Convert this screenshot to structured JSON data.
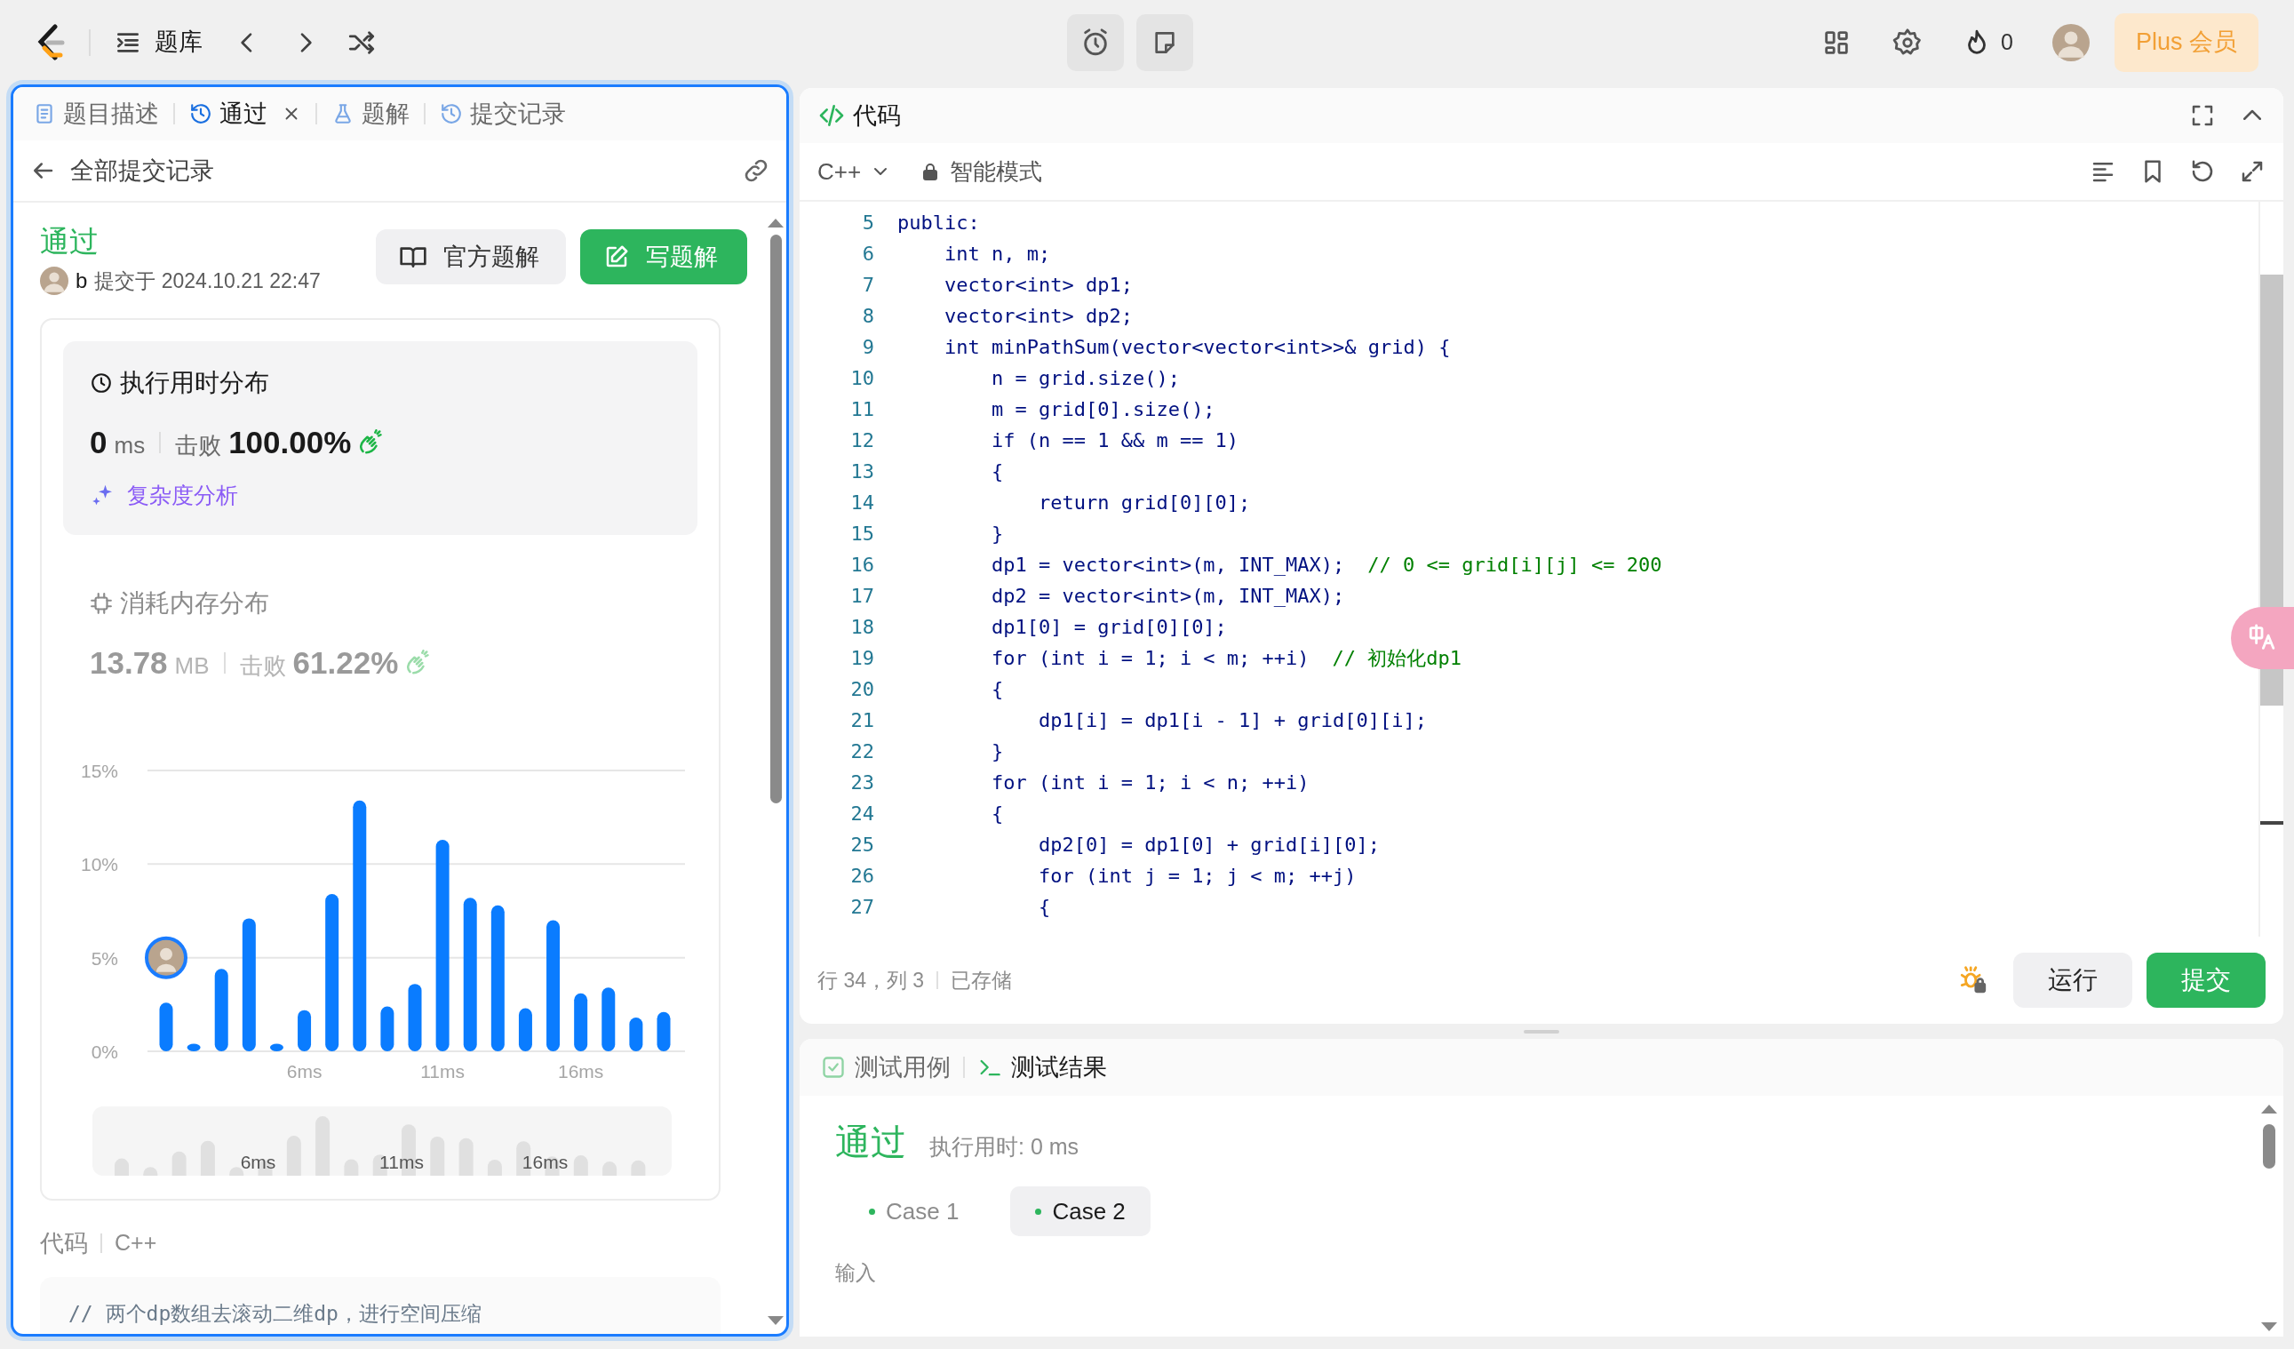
{
  "topbar": {
    "nav_label": "题库",
    "streak": "0",
    "plus_label": "Plus 会员"
  },
  "left_panel": {
    "tabs": [
      {
        "label": "题目描述",
        "selected": false,
        "closable": false
      },
      {
        "label": "通过",
        "selected": true,
        "closable": true
      },
      {
        "label": "题解",
        "selected": false,
        "closable": false
      },
      {
        "label": "提交记录",
        "selected": false,
        "closable": false
      }
    ],
    "back_label": "全部提交记录",
    "submission": {
      "status": "通过",
      "user": "b",
      "submitted": "提交于 2024.10.21 22:47"
    },
    "buttons": [
      {
        "label": "官方题解",
        "kind": "secondary"
      },
      {
        "label": "写题解",
        "kind": "primary"
      }
    ],
    "runtime": {
      "title": "执行用时分布",
      "value": "0",
      "unit": "ms",
      "beat_label": "击败",
      "beat": "100.00%",
      "analysis_link": "复杂度分析",
      "selected": true
    },
    "memory": {
      "title": "消耗内存分布",
      "value": "13.78",
      "unit": "MB",
      "beat_label": "击败",
      "beat": "61.22%",
      "selected": false
    },
    "chart_data": {
      "type": "bar",
      "categories": [
        null,
        null,
        null,
        null,
        null,
        "6ms",
        null,
        null,
        null,
        null,
        "11ms",
        null,
        null,
        null,
        null,
        "16ms",
        null,
        null,
        null
      ],
      "series": [
        {
          "color": "#0a7cff",
          "values": [
            2.6,
            0.4,
            4.4,
            7.1,
            0.4,
            2.2,
            8.4,
            13.4,
            2.4,
            3.6,
            11.3,
            8.2,
            7.8,
            2.3,
            7.0,
            3.1,
            3.4,
            1.8,
            2.1
          ]
        }
      ],
      "ylim": [
        0,
        15
      ],
      "yticks": [
        {
          "value": 0,
          "label": "0%"
        },
        {
          "value": 5,
          "label": "5%"
        },
        {
          "value": 10,
          "label": "10%"
        },
        {
          "value": 15,
          "label": "15%"
        }
      ]
    },
    "overview": {
      "tick_labels": [
        "6ms",
        "11ms",
        "16ms"
      ]
    },
    "code_label": "代码",
    "code_language": "C++",
    "code_preview": "// 两个dp数组去滚动二维dp，进行空间压缩"
  },
  "editor": {
    "title": "代码",
    "language": "C++",
    "mode": "智能模式",
    "lines": [
      {
        "no": "5",
        "text": "public:"
      },
      {
        "no": "6",
        "text": "    int n, m;"
      },
      {
        "no": "7",
        "text": "    vector<int> dp1;"
      },
      {
        "no": "8",
        "text": "    vector<int> dp2;"
      },
      {
        "no": "9",
        "text": "    int minPathSum(vector<vector<int>>& grid) {"
      },
      {
        "no": "10",
        "text": "        n = grid.size();"
      },
      {
        "no": "11",
        "text": "        m = grid[0].size();"
      },
      {
        "no": "12",
        "text": "        if (n == 1 && m == 1)"
      },
      {
        "no": "13",
        "text": "        {"
      },
      {
        "no": "14",
        "text": "            return grid[0][0];"
      },
      {
        "no": "15",
        "text": "        }"
      },
      {
        "no": "16",
        "text": "        dp1 = vector<int>(m, INT_MAX);",
        "comment": "// 0 <= grid[i][j] <= 200"
      },
      {
        "no": "17",
        "text": "        dp2 = vector<int>(m, INT_MAX);"
      },
      {
        "no": "18",
        "text": "        dp1[0] = grid[0][0];"
      },
      {
        "no": "19",
        "text": "        for (int i = 1; i < m; ++i)",
        "comment": "// 初始化dp1"
      },
      {
        "no": "20",
        "text": "        {"
      },
      {
        "no": "21",
        "text": "            dp1[i] = dp1[i - 1] + grid[0][i];"
      },
      {
        "no": "22",
        "text": "        }"
      },
      {
        "no": "23",
        "text": "        for (int i = 1; i < n; ++i)"
      },
      {
        "no": "24",
        "text": "        {"
      },
      {
        "no": "25",
        "text": "            dp2[0] = dp1[0] + grid[i][0];"
      },
      {
        "no": "26",
        "text": "            for (int j = 1; j < m; ++j)"
      },
      {
        "no": "27",
        "text": "            {"
      }
    ],
    "status": "行 34，列 3",
    "saved": "已存储",
    "buttons": [
      {
        "label": "运行",
        "kind": "secondary"
      },
      {
        "label": "提交",
        "kind": "primary"
      }
    ]
  },
  "console": {
    "tabs": [
      {
        "label": "测试用例",
        "selected": false
      },
      {
        "label": "测试结果",
        "selected": true
      }
    ],
    "status": "通过",
    "runtime": "执行用时: 0 ms",
    "cases": [
      {
        "label": "Case 1",
        "selected": false
      },
      {
        "label": "Case 2",
        "selected": true
      }
    ],
    "input_label": "输入"
  }
}
